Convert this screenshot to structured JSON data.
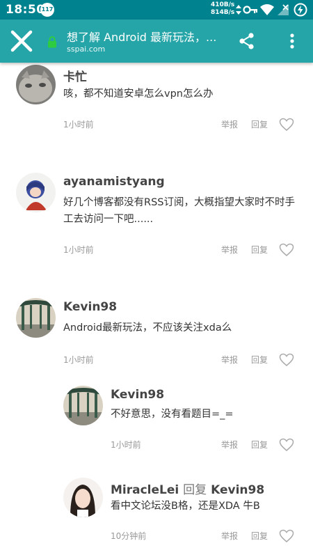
{
  "status_bar": {
    "time": "18:50",
    "notification_badge": "117",
    "speed_up": "410B/s",
    "speed_down": "814B/s"
  },
  "toolbar": {
    "title": "想了解 Android 最新玩法，...",
    "url": "sspai.com",
    "icons": [
      "close-icon",
      "lock-icon",
      "share-icon",
      "more-vert-icon"
    ]
  },
  "colors": {
    "status_bar": "#00838F",
    "toolbar": "#26A5A8",
    "lock_green": "#2ECC40",
    "meta_gray": "#999999"
  },
  "actions": {
    "report": "举报",
    "reply": "回复"
  },
  "comments": [
    {
      "author": "卡忙",
      "text": "咳，都不知道安卓怎么vpn怎么办",
      "time": "1小时前"
    },
    {
      "author": "ayanamistyang",
      "text": "好几个博客都没有RSS订阅，大概指望大家时不时手工去访问一下吧......",
      "time": "1小时前"
    },
    {
      "author": "Kevin98",
      "text": "Android最新玩法，不应该关注xda么",
      "time": "1小时前"
    },
    {
      "author": "Kevin98",
      "text": "不好意思，没有看题目=_=",
      "time": "1小时前"
    },
    {
      "author": "MiracleLei",
      "reply_word": "回复",
      "reply_to": "Kevin98",
      "text": "看中文论坛没B格，还是XDA 牛B",
      "time": "10分钟前"
    }
  ]
}
